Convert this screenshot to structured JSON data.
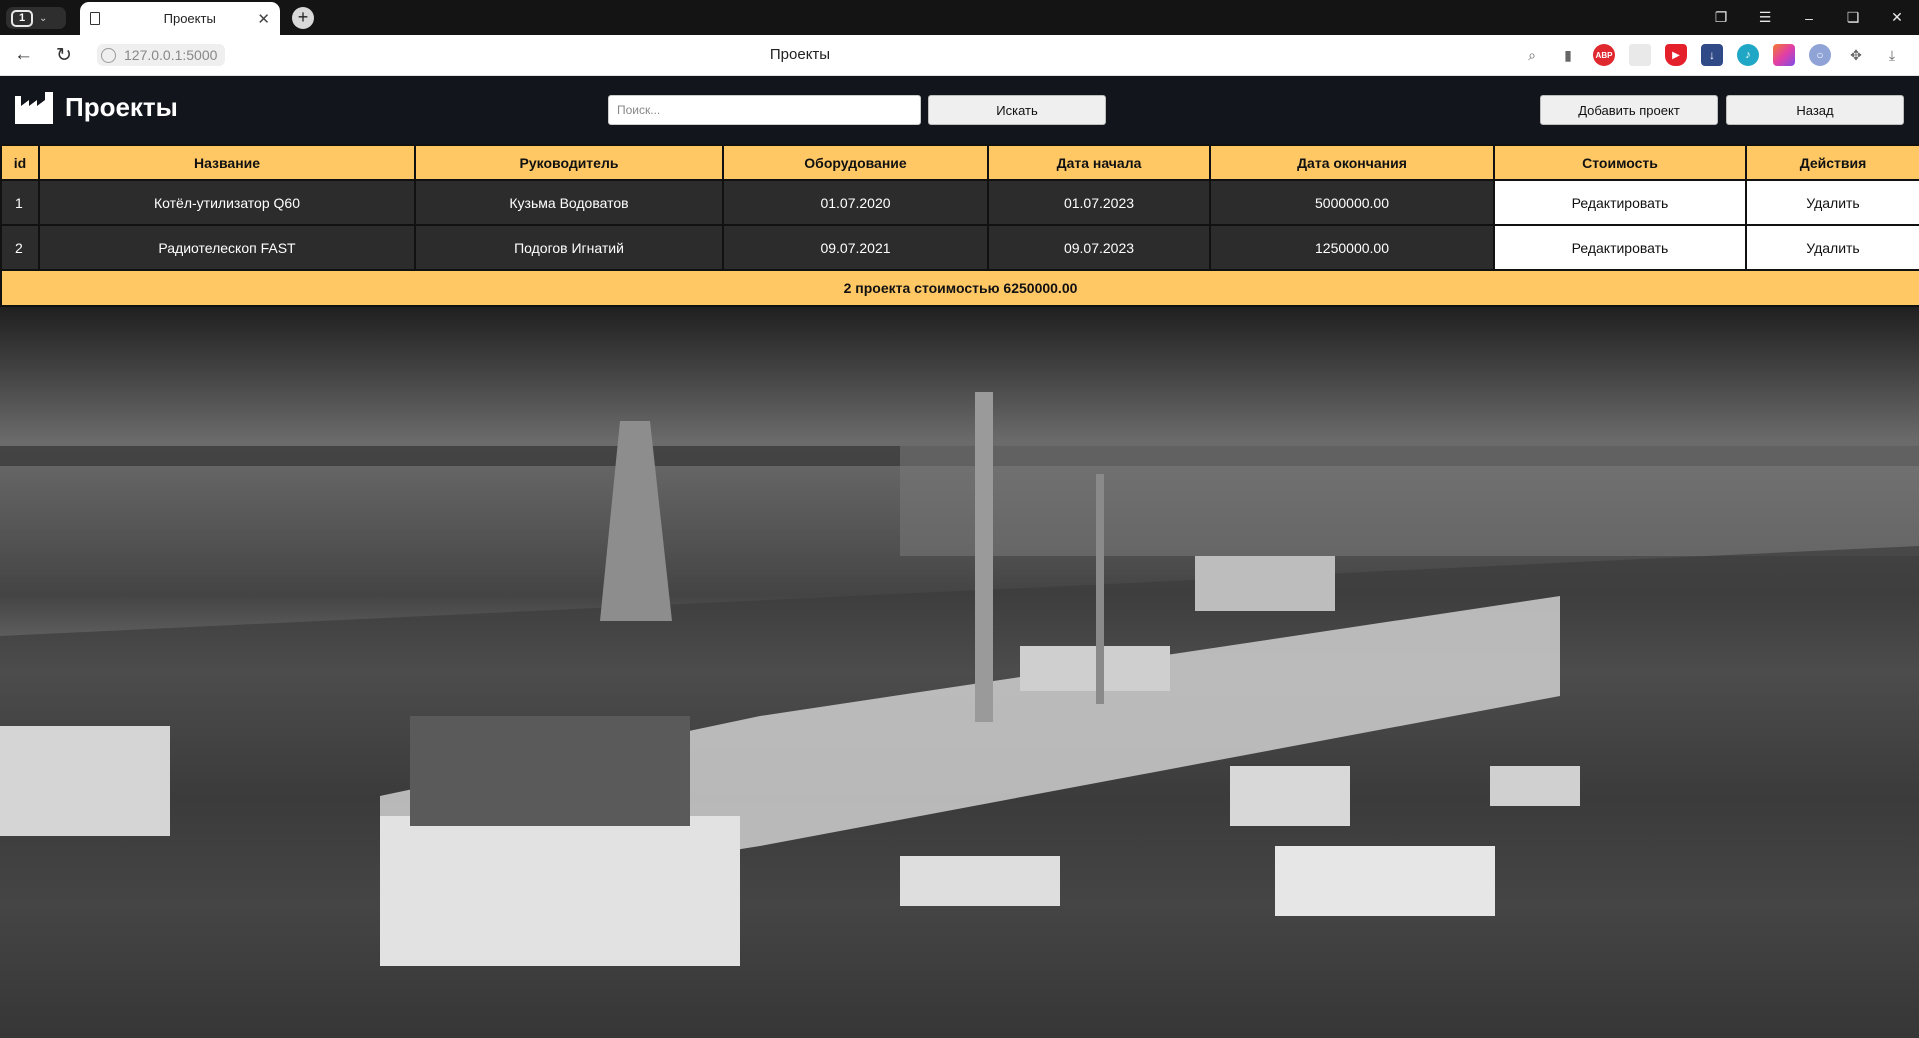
{
  "browser": {
    "tab_count": "1",
    "tab_title": "Проекты",
    "url": "127.0.0.1:5000",
    "address_title": "Проекты",
    "extensions": [
      "abp-icon",
      "blank-extension-icon",
      "shield-extension-icon",
      "download-extension-icon",
      "tiktok-extension-icon",
      "gradient-extension-icon",
      "lens-extension-icon"
    ]
  },
  "header": {
    "title": "Проекты",
    "search_placeholder": "Поиск...",
    "search_button": "Искать",
    "add_button": "Добавить проект",
    "back_button": "Назад"
  },
  "table": {
    "columns": [
      "id",
      "Название",
      "Руководитель",
      "Оборудование",
      "Дата начала",
      "Дата окончания",
      "Стоимость",
      "Действия"
    ],
    "rows": [
      {
        "id": "1",
        "name": "Котёл-утилизатор Q60",
        "manager": "Кузьма Водоватов",
        "equipment": "01.07.2020",
        "start": "01.07.2023",
        "end": "5000000.00",
        "edit": "Редактировать",
        "delete": "Удалить"
      },
      {
        "id": "2",
        "name": "Радиотелескоп FAST",
        "manager": "Подогов Игнатий",
        "equipment": "09.07.2021",
        "start": "09.07.2023",
        "end": "1250000.00",
        "edit": "Редактировать",
        "delete": "Удалить"
      }
    ],
    "footer": "2 проекта стоимостью 6250000.00"
  }
}
